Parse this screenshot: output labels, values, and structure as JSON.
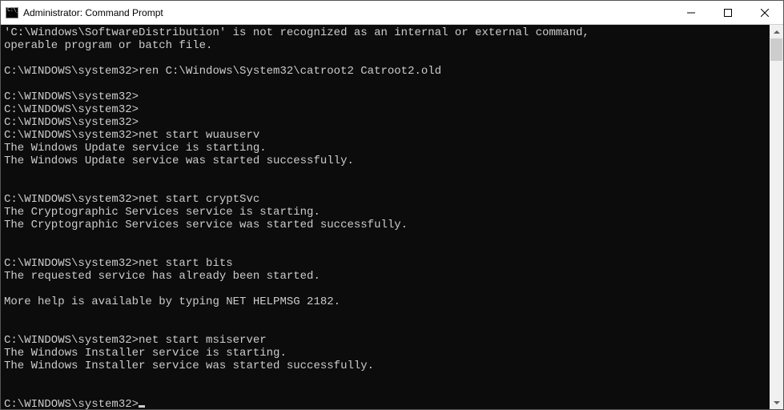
{
  "window": {
    "title": "Administrator: Command Prompt"
  },
  "console": {
    "lines": [
      "'C:\\Windows\\SoftwareDistribution' is not recognized as an internal or external command,",
      "operable program or batch file.",
      "",
      "C:\\WINDOWS\\system32>ren C:\\Windows\\System32\\catroot2 Catroot2.old",
      "",
      "C:\\WINDOWS\\system32>",
      "C:\\WINDOWS\\system32>",
      "C:\\WINDOWS\\system32>",
      "C:\\WINDOWS\\system32>net start wuauserv",
      "The Windows Update service is starting.",
      "The Windows Update service was started successfully.",
      "",
      "",
      "C:\\WINDOWS\\system32>net start cryptSvc",
      "The Cryptographic Services service is starting.",
      "The Cryptographic Services service was started successfully.",
      "",
      "",
      "C:\\WINDOWS\\system32>net start bits",
      "The requested service has already been started.",
      "",
      "More help is available by typing NET HELPMSG 2182.",
      "",
      "",
      "C:\\WINDOWS\\system32>net start msiserver",
      "The Windows Installer service is starting.",
      "The Windows Installer service was started successfully.",
      "",
      "",
      "C:\\WINDOWS\\system32>"
    ]
  }
}
